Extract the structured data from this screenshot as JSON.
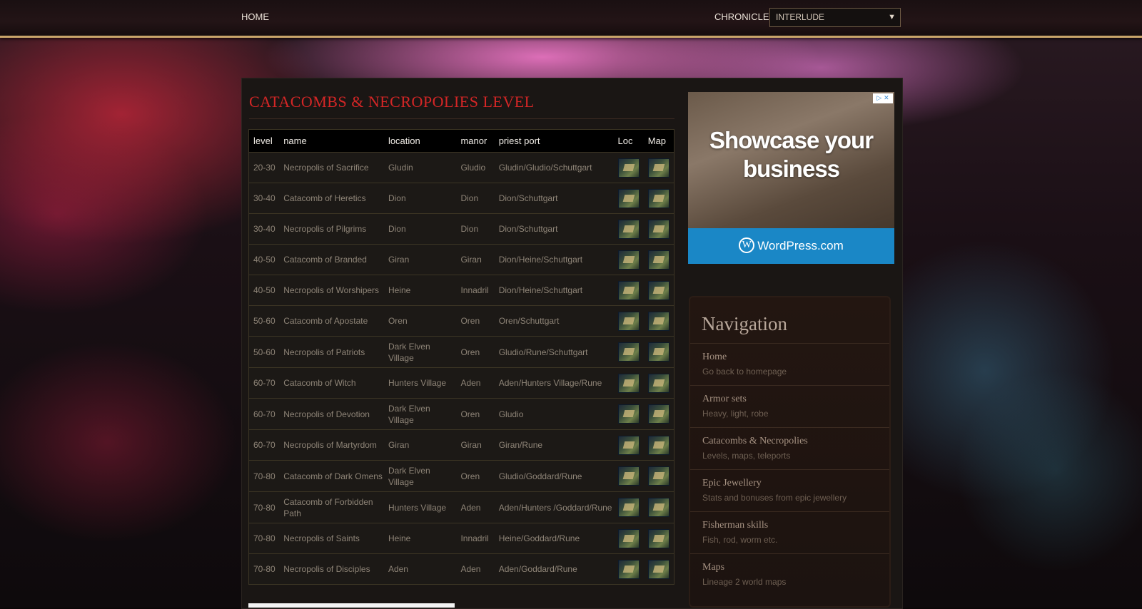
{
  "topbar": {
    "home_label": "HOME",
    "chronicle_label": "CHRONICLE:",
    "chronicle_selected": "INTERLUDE"
  },
  "page": {
    "title": "CATACOMBS & NECROPOLIES LEVEL"
  },
  "table": {
    "headers": [
      "level",
      "name",
      "location",
      "manor",
      "priest port",
      "Loc",
      "Map"
    ],
    "rows": [
      {
        "level": "20-30",
        "name": "Necropolis of Sacrifice",
        "location": "Gludin",
        "manor": "Gludio",
        "port": "Gludin/Gludio/Schuttgart"
      },
      {
        "level": "30-40",
        "name": "Catacomb of Heretics",
        "location": "Dion",
        "manor": "Dion",
        "port": "Dion/Schuttgart"
      },
      {
        "level": "30-40",
        "name": "Necropolis of Pilgrims",
        "location": "Dion",
        "manor": "Dion",
        "port": "Dion/Schuttgart"
      },
      {
        "level": "40-50",
        "name": "Catacomb of Branded",
        "location": "Giran",
        "manor": "Giran",
        "port": "Dion/Heine/Schuttgart"
      },
      {
        "level": "40-50",
        "name": "Necropolis of Worshipers",
        "location": "Heine",
        "manor": "Innadril",
        "port": "Dion/Heine/Schuttgart"
      },
      {
        "level": "50-60",
        "name": "Catacomb of Apostate",
        "location": "Oren",
        "manor": "Oren",
        "port": "Oren/Schuttgart"
      },
      {
        "level": "50-60",
        "name": "Necropolis of Patriots",
        "location": "Dark Elven Village",
        "manor": "Oren",
        "port": "Gludio/Rune/Schuttgart"
      },
      {
        "level": "60-70",
        "name": "Catacomb of Witch",
        "location": "Hunters Village",
        "manor": "Aden",
        "port": "Aden/Hunters Village/Rune"
      },
      {
        "level": "60-70",
        "name": "Necropolis of Devotion",
        "location": "Dark Elven Village",
        "manor": "Oren",
        "port": "Gludio"
      },
      {
        "level": "60-70",
        "name": "Necropolis of Martyrdom",
        "location": "Giran",
        "manor": "Giran",
        "port": "Giran/Rune"
      },
      {
        "level": "70-80",
        "name": "Catacomb of Dark Omens",
        "location": "Dark Elven Village",
        "manor": "Oren",
        "port": "Gludio/Goddard/Rune"
      },
      {
        "level": "70-80",
        "name": "Catacomb of Forbidden Path",
        "location": "Hunters Village",
        "manor": "Aden",
        "port": "Aden/Hunters /Goddard/Rune"
      },
      {
        "level": "70-80",
        "name": "Necropolis of Saints",
        "location": "Heine",
        "manor": "Innadril",
        "port": "Heine/Goddard/Rune"
      },
      {
        "level": "70-80",
        "name": "Necropolis of Disciples",
        "location": "Aden",
        "manor": "Aden",
        "port": "Aden/Goddard/Rune"
      }
    ]
  },
  "ad": {
    "headline": "Showcase your business",
    "brand": "WordPress.com"
  },
  "navigation": {
    "title": "Navigation",
    "items": [
      {
        "title": "Home",
        "subtitle": "Go back to homepage"
      },
      {
        "title": "Armor sets",
        "subtitle": "Heavy, light, robe"
      },
      {
        "title": "Catacombs & Necropolies",
        "subtitle": "Levels, maps, teleports"
      },
      {
        "title": "Epic Jewellery",
        "subtitle": "Stats and bonuses from epic jewellery"
      },
      {
        "title": "Fisherman skills",
        "subtitle": "Fish, rod, worm etc."
      },
      {
        "title": "Maps",
        "subtitle": "Lineage 2 world maps"
      }
    ]
  },
  "colors": {
    "title_red": "#d42626",
    "gold_border": "#c9a56a",
    "wp_blue": "#1a87c6"
  }
}
